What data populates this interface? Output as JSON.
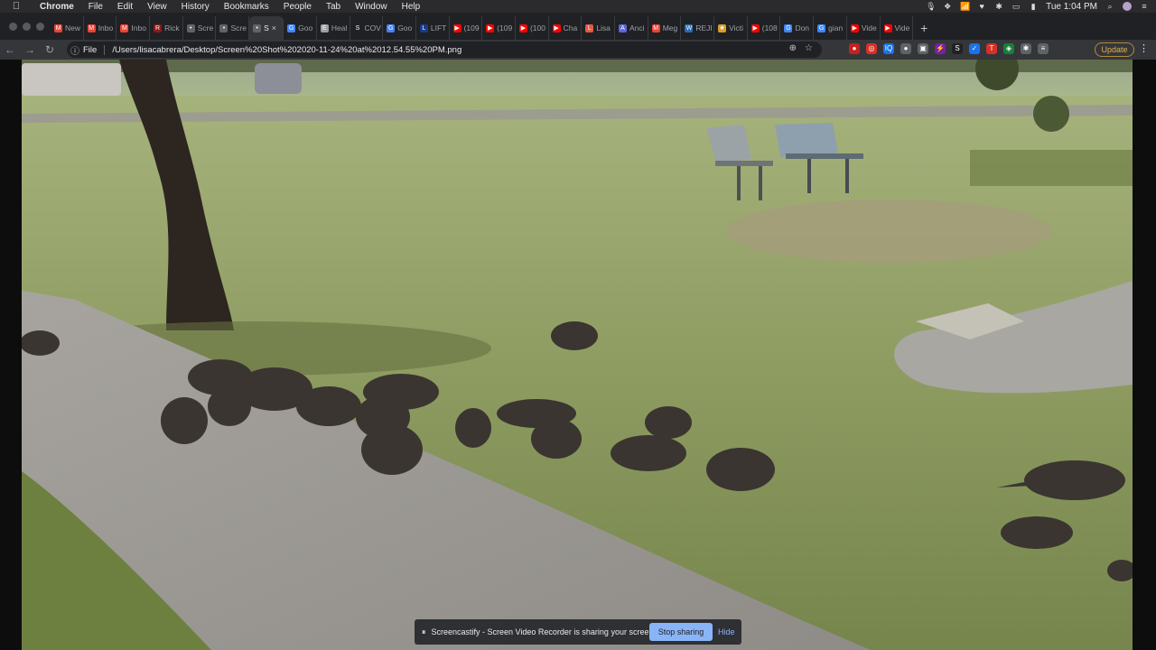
{
  "menubar": {
    "apple": "",
    "items": [
      "Chrome",
      "File",
      "Edit",
      "View",
      "History",
      "Bookmarks",
      "People",
      "Tab",
      "Window",
      "Help"
    ],
    "clock": "Tue 1:04 PM"
  },
  "tabs": [
    {
      "label": "New",
      "color": "#ea4335",
      "glyph": "M"
    },
    {
      "label": "Inbo",
      "color": "#ea4335",
      "glyph": "M"
    },
    {
      "label": "Inbo",
      "color": "#ea4335",
      "glyph": "M"
    },
    {
      "label": "Rick",
      "color": "#8b1a1a",
      "glyph": "R"
    },
    {
      "label": "Scre",
      "color": "#5f6368",
      "glyph": "•"
    },
    {
      "label": "Scre",
      "color": "#5f6368",
      "glyph": "•"
    },
    {
      "label": "S",
      "color": "#5f6368",
      "glyph": "•",
      "active": true
    },
    {
      "label": "Goo",
      "color": "#4285f4",
      "glyph": "G"
    },
    {
      "label": "Heal",
      "color": "#9aa0a6",
      "glyph": "E"
    },
    {
      "label": "COV",
      "color": "#202124",
      "glyph": "S"
    },
    {
      "label": "Goo",
      "color": "#4285f4",
      "glyph": "G"
    },
    {
      "label": "LIFT",
      "color": "#1a3a8b",
      "glyph": "L"
    },
    {
      "label": "(109",
      "color": "#ff0000",
      "glyph": "▶"
    },
    {
      "label": "(109",
      "color": "#ff0000",
      "glyph": "▶"
    },
    {
      "label": "(100",
      "color": "#ff0000",
      "glyph": "▶"
    },
    {
      "label": "Cha",
      "color": "#ff0000",
      "glyph": "▶"
    },
    {
      "label": "Lisa",
      "color": "#e05a47",
      "glyph": "L"
    },
    {
      "label": "Anci",
      "color": "#5a67d8",
      "glyph": "A"
    },
    {
      "label": "Meg",
      "color": "#ea4335",
      "glyph": "M"
    },
    {
      "label": "REJI",
      "color": "#2b6cb0",
      "glyph": "W"
    },
    {
      "label": "Victi",
      "color": "#d69e2e",
      "glyph": "★"
    },
    {
      "label": "(108",
      "color": "#ff0000",
      "glyph": "▶"
    },
    {
      "label": "Don",
      "color": "#4285f4",
      "glyph": "G"
    },
    {
      "label": "gian",
      "color": "#4285f4",
      "glyph": "G"
    },
    {
      "label": "Vide",
      "color": "#ff0000",
      "glyph": "▶"
    },
    {
      "label": "Vide",
      "color": "#ff0000",
      "glyph": "▶"
    }
  ],
  "omnibox": {
    "scheme": "File",
    "url": "/Users/lisacabrera/Desktop/Screen%20Shot%202020-11-24%20at%2012.54.55%20PM.png"
  },
  "toolbar": {
    "update_label": "Update",
    "extensions": [
      {
        "color": "#c5221f",
        "glyph": "●"
      },
      {
        "color": "#d93025",
        "glyph": "◎"
      },
      {
        "color": "#1a73e8",
        "glyph": "IQ"
      },
      {
        "color": "#5f6368",
        "glyph": "●"
      },
      {
        "color": "#5f6368",
        "glyph": "▣"
      },
      {
        "color": "#7b1fa2",
        "glyph": "⚡"
      },
      {
        "color": "#202124",
        "glyph": "S"
      },
      {
        "color": "#1a73e8",
        "glyph": "✓"
      },
      {
        "color": "#d93025",
        "glyph": "T"
      },
      {
        "color": "#188038",
        "glyph": "◈"
      },
      {
        "color": "#5f6368",
        "glyph": "✱"
      },
      {
        "color": "#5f6368",
        "glyph": "≡"
      }
    ]
  },
  "sharebar": {
    "message": "Screencastify - Screen Video Recorder is sharing your screen.",
    "stop_label": "Stop sharing",
    "hide_label": "Hide"
  }
}
